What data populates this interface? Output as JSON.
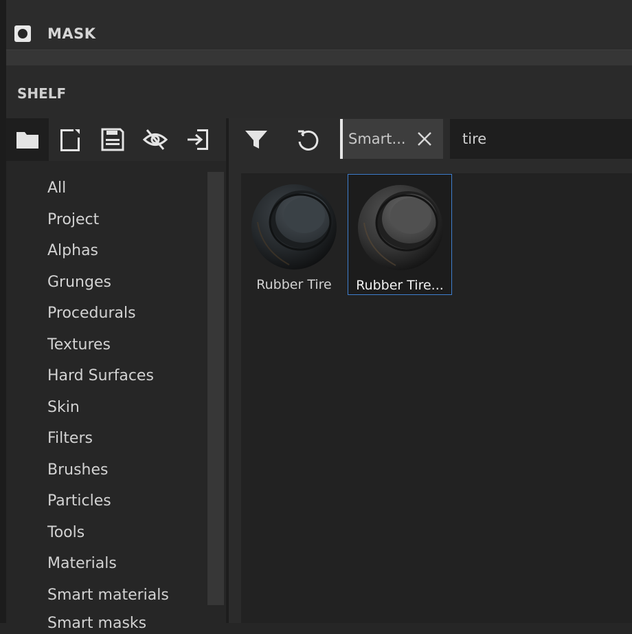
{
  "mask_panel": {
    "title": "MASK",
    "icon": "mask-circle-icon"
  },
  "shelf": {
    "title": "SHELF",
    "toolbar": [
      {
        "name": "folder-icon",
        "active": true
      },
      {
        "name": "new-document-icon",
        "active": false
      },
      {
        "name": "save-icon",
        "active": false
      },
      {
        "name": "eye-hidden-icon",
        "active": false
      },
      {
        "name": "import-icon",
        "active": false
      }
    ],
    "categories": [
      "All",
      "Project",
      "Alphas",
      "Grunges",
      "Procedurals",
      "Textures",
      "Hard Surfaces",
      "Skin",
      "Filters",
      "Brushes",
      "Particles",
      "Tools",
      "Materials",
      "Smart materials",
      "Smart masks"
    ],
    "filter_chip": {
      "label": "Smart...",
      "close_icon": "close-icon"
    },
    "search": {
      "value": "tire"
    },
    "assets": [
      {
        "label": "Rubber Tire",
        "selected": false
      },
      {
        "label": "Rubber Tire...",
        "selected": true
      }
    ]
  },
  "colors": {
    "background": "#262626",
    "panel": "#2b2b2b",
    "selection": "#3f7fd0",
    "text": "#d2d2d2"
  }
}
